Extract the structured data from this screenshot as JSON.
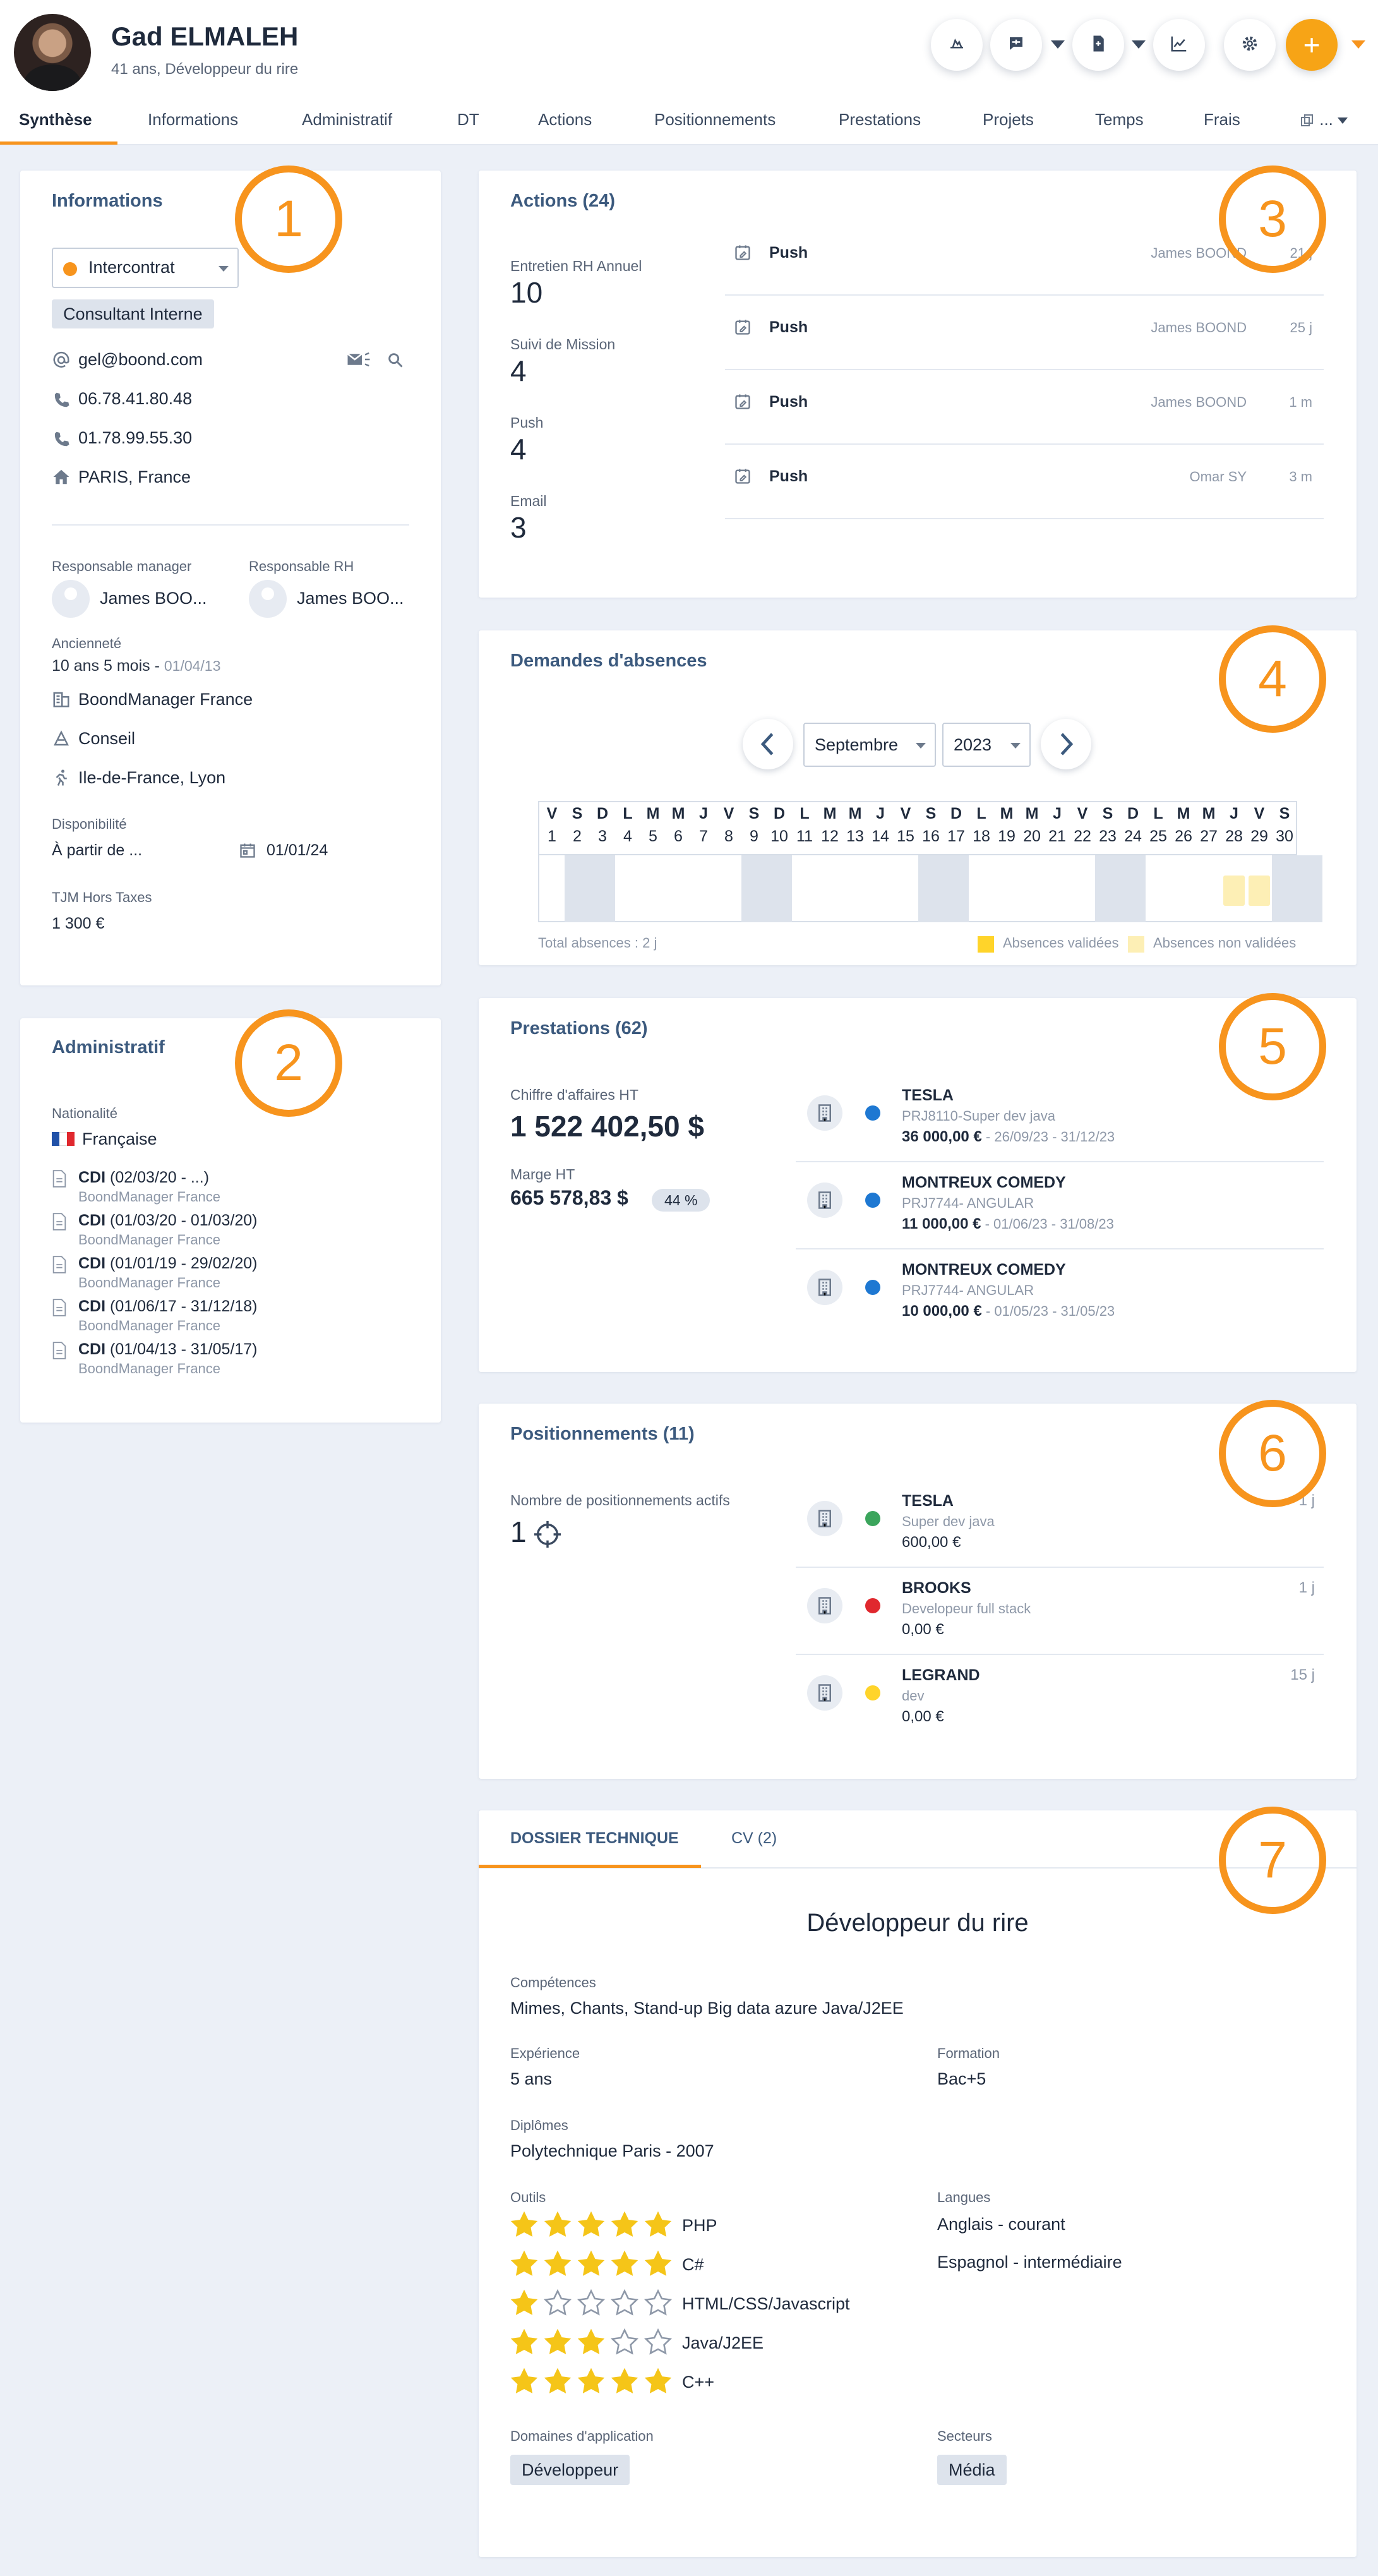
{
  "header": {
    "name": "Gad ELMALEH",
    "subtitle": "41 ans, Développeur du rire",
    "add_label": "+"
  },
  "tabs": [
    "Synthèse",
    "Informations",
    "Administratif",
    "DT",
    "Actions",
    "Positionnements",
    "Prestations",
    "Projets",
    "Temps",
    "Frais"
  ],
  "tabs_more": "...",
  "informations": {
    "title": "Informations",
    "status": "Intercontrat",
    "type": "Consultant Interne",
    "email": "gel@boond.com",
    "phone1": "06.78.41.80.48",
    "phone2": "01.78.99.55.30",
    "address": "PARIS, France",
    "manager_label": "Responsable manager",
    "manager_name": "James BOO...",
    "rh_label": "Responsable RH",
    "rh_name": "James BOO...",
    "seniority_label": "Ancienneté",
    "seniority": "10 ans 5 mois",
    "seniority_sep": " - ",
    "seniority_date": "01/04/13",
    "agency": "BoondManager France",
    "pole": "Conseil",
    "location": "Ile-de-France, Lyon",
    "availability_label": "Disponibilité",
    "availability": "À partir de ...",
    "availability_date": "01/01/24",
    "tjm_label": "TJM Hors Taxes",
    "tjm": "1 300 €"
  },
  "administratif": {
    "title": "Administratif",
    "nationality_label": "Nationalité",
    "nationality": "Française",
    "contracts": [
      {
        "type": "CDI",
        "period": " (02/03/20 - ...)",
        "company": "BoondManager France"
      },
      {
        "type": "CDI",
        "period": " (01/03/20 - 01/03/20)",
        "company": "BoondManager France"
      },
      {
        "type": "CDI",
        "period": " (01/01/19 - 29/02/20)",
        "company": "BoondManager France"
      },
      {
        "type": "CDI",
        "period": " (01/06/17 - 31/12/18)",
        "company": "BoondManager France"
      },
      {
        "type": "CDI",
        "period": " (01/04/13 - 31/05/17)",
        "company": "BoondManager France"
      }
    ]
  },
  "actions": {
    "title": "Actions (24)",
    "stats": [
      {
        "label": "Entretien RH Annuel",
        "value": "10"
      },
      {
        "label": "Suivi de Mission",
        "value": "4"
      },
      {
        "label": "Push",
        "value": "4"
      },
      {
        "label": "Email",
        "value": "3"
      }
    ],
    "items": [
      {
        "type": "Push",
        "user": "James BOOND",
        "ago": "21 j"
      },
      {
        "type": "Push",
        "user": "James BOOND",
        "ago": "25 j"
      },
      {
        "type": "Push",
        "user": "James BOOND",
        "ago": "1 m"
      },
      {
        "type": "Push",
        "user": "Omar SY",
        "ago": "3 m"
      }
    ]
  },
  "absences": {
    "title": "Demandes d'absences",
    "month": "Septembre",
    "year": "2023",
    "weekdays": [
      "V",
      "S",
      "D",
      "L",
      "M",
      "M",
      "J",
      "V",
      "S",
      "D",
      "L",
      "M",
      "M",
      "J",
      "V",
      "S",
      "D",
      "L",
      "M",
      "M",
      "J",
      "V",
      "S",
      "D",
      "L",
      "M",
      "M",
      "J",
      "V",
      "S"
    ],
    "days": [
      "1",
      "2",
      "3",
      "4",
      "5",
      "6",
      "7",
      "8",
      "9",
      "10",
      "11",
      "12",
      "13",
      "14",
      "15",
      "16",
      "17",
      "18",
      "19",
      "20",
      "21",
      "22",
      "23",
      "24",
      "25",
      "26",
      "27",
      "28",
      "29",
      "30"
    ],
    "total": "Total absences : 2 j",
    "legend_validated": "Absences validées",
    "legend_not_validated": "Absences non validées",
    "color_validated": "#FFD42A",
    "color_not_validated": "#FDEFB5"
  },
  "prestations": {
    "title": "Prestations (62)",
    "ca_label": "Chiffre d'affaires HT",
    "ca": "1 522 402,50 $",
    "marge_label": "Marge HT",
    "marge": "665 578,83 $",
    "marge_pct": "44 %",
    "items": [
      {
        "company": "TESLA",
        "project": "PRJ8110-Super dev java",
        "amount": "36 000,00 €",
        "dates": " - 26/09/23 - 31/12/23",
        "color": "#1E78D2"
      },
      {
        "company": "MONTREUX COMEDY",
        "project": "PRJ7744- ANGULAR",
        "amount": "11 000,00 €",
        "dates": " - 01/06/23 - 31/08/23",
        "color": "#1E78D2"
      },
      {
        "company": "MONTREUX COMEDY",
        "project": "PRJ7744- ANGULAR",
        "amount": "10 000,00 €",
        "dates": " - 01/05/23 - 31/05/23",
        "color": "#1E78D2"
      }
    ]
  },
  "positionnements": {
    "title": "Positionnements (11)",
    "active_label": "Nombre de positionnements actifs",
    "active_count": "1",
    "items": [
      {
        "company": "TESLA",
        "role": "Super dev java",
        "amount": "600,00 €",
        "ago": "1 j",
        "color": "#3BA55C"
      },
      {
        "company": "BROOKS",
        "role": "Developeur full stack",
        "amount": "0,00 €",
        "ago": "1 j",
        "color": "#E0282E"
      },
      {
        "company": "LEGRAND",
        "role": "dev",
        "amount": "0,00 €",
        "ago": "15 j",
        "color": "#FFD42A"
      }
    ]
  },
  "dt": {
    "tab_dt": "DOSSIER TECHNIQUE",
    "tab_cv": "CV (2)",
    "title": "Développeur du rire",
    "skills_label": "Compétences",
    "skills": "Mimes, Chants, Stand-up Big data azure Java/J2EE",
    "experience_label": "Expérience",
    "experience": "5 ans",
    "formation_label": "Formation",
    "formation": "Bac+5",
    "diplomes_label": "Diplômes",
    "diplomes": "Polytechnique Paris - 2007",
    "tools_label": "Outils",
    "tools": [
      {
        "name": "PHP",
        "rating": 5
      },
      {
        "name": "C#",
        "rating": 5
      },
      {
        "name": "HTML/CSS/Javascript",
        "rating": 1
      },
      {
        "name": "Java/J2EE",
        "rating": 3
      },
      {
        "name": "C++",
        "rating": 5
      }
    ],
    "langues_label": "Langues",
    "langues": [
      "Anglais - courant",
      "Espagnol - intermédiaire"
    ],
    "domains_label": "Domaines d'application",
    "domain": "Développeur",
    "sectors_label": "Secteurs",
    "sector": "Média"
  },
  "annotations": [
    "1",
    "2",
    "3",
    "4",
    "5",
    "6",
    "7"
  ],
  "colors": {
    "accent": "#F7941D",
    "title": "#3C5A7E",
    "star": "#F5C518"
  }
}
